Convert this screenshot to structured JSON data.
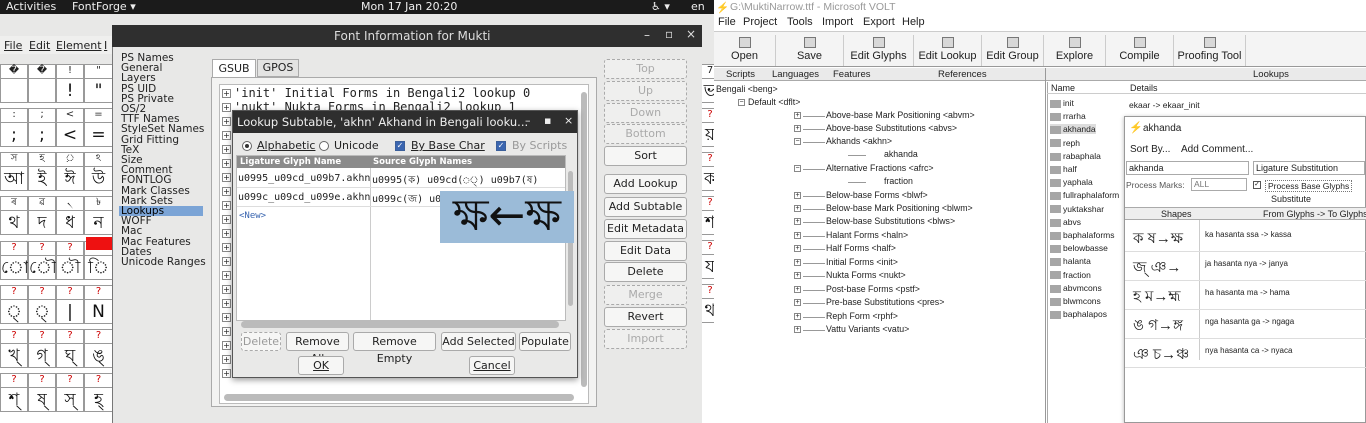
{
  "topbar": {
    "activities": "Activities",
    "app_menu": "FontForge ▾",
    "clock": "Mon 17 Jan  20:20",
    "sys_icons": "♿ ▾",
    "lang": "en"
  },
  "fontforge": {
    "menubar": [
      "File",
      "Edit",
      "Element",
      "I"
    ],
    "window_title": "Font Information for Mukti",
    "nav_items": [
      "PS Names",
      "General",
      "Layers",
      "PS UID",
      "PS Private",
      "OS/2",
      "TTF Names",
      "StyleSet Names",
      "Grid Fitting",
      "TeX",
      "Size",
      "Comment",
      "FONTLOG",
      "Mark Classes",
      "Mark Sets",
      "Lookups",
      "WOFF",
      "Mac",
      "Mac Features",
      "Dates",
      "Unicode Ranges"
    ],
    "nav_selected": "Lookups",
    "tabs": [
      "GSUB",
      "GPOS"
    ],
    "lookups": [
      "'init' Initial Forms in Bengali2 lookup 0",
      "'nukt' Nukta Forms in Bengali2 lookup 1"
    ],
    "side_buttons": [
      {
        "label": "Top",
        "enabled": false
      },
      {
        "label": "Up",
        "enabled": false
      },
      {
        "label": "Down",
        "enabled": false
      },
      {
        "label": "Bottom",
        "enabled": false
      },
      {
        "label": "Sort",
        "enabled": true
      },
      {
        "label": "Add Lookup",
        "enabled": true
      },
      {
        "label": "Add Subtable",
        "enabled": true
      },
      {
        "label": "Edit Metadata",
        "enabled": true
      },
      {
        "label": "Edit Data",
        "enabled": true
      },
      {
        "label": "Delete",
        "enabled": true
      },
      {
        "label": "Merge",
        "enabled": false
      },
      {
        "label": "Revert",
        "enabled": true
      },
      {
        "label": "Import",
        "enabled": false
      }
    ],
    "grid_left_labels": [
      [
        "�",
        "�",
        "!",
        "\""
      ],
      [
        ":",
        ";",
        "<",
        "="
      ],
      [
        "স",
        "হ",
        "়",
        "ঽ"
      ],
      [
        "ৰ",
        "ৱ",
        "৲",
        "৳"
      ],
      [
        "?",
        "?",
        "?",
        "?"
      ],
      [
        "?",
        "?",
        "?",
        "?"
      ],
      [
        "?",
        "?",
        "?",
        "?"
      ],
      [
        "?",
        "?",
        "?",
        "?"
      ]
    ],
    "grid_left_glyphs": [
      [
        "",
        "",
        "!",
        "\""
      ],
      [
        ";",
        ";",
        "<",
        "="
      ],
      [
        "আ",
        "ই",
        "ঈ",
        "উ"
      ],
      [
        "থ",
        "দ",
        "ধ",
        "ন"
      ],
      [
        "ো",
        "ৌ",
        "ৗ",
        "ি"
      ],
      [
        "্",
        "্",
        "|",
        "N"
      ],
      [
        "খ্",
        "গ্",
        "ঘ্",
        "ঙ্"
      ],
      [
        "শ্",
        "ষ্",
        "স্",
        "হ্"
      ]
    ],
    "grid_right_labels": [
      "7",
      "?",
      "?",
      "?",
      "?",
      "?",
      "?"
    ],
    "grid_right_glyphs": [
      "ভ",
      "য়",
      "ক",
      "শ",
      "য",
      "থ"
    ]
  },
  "dialog": {
    "title": "Lookup Subtable, 'akhn' Akhand in Bengali looku...",
    "controls": [
      "–",
      "▪",
      "×"
    ],
    "options": {
      "alphabetic": "Alphabetic",
      "unicode": "Unicode",
      "by_base_char": "By Base Char",
      "by_scripts": "By Scripts"
    },
    "columns": [
      "Ligature Glyph Name",
      "Source Glyph Names"
    ],
    "rows": [
      {
        "lig": "u0995_u09cd_u09b7.akhn",
        "src": "u0995(ক) u09cd(◌্) u09b7(ষ)"
      },
      {
        "lig": "u099c_u09cd_u099e.akhn",
        "src": "u099c(জ) u09"
      }
    ],
    "new_row": "<New>",
    "preview": "ক্ষ←ক্ষ",
    "buttons": [
      "Delete",
      "Remove All",
      "Remove Empty",
      "Add Selected",
      "Populate"
    ],
    "ok": "OK",
    "cancel": "Cancel"
  },
  "volt": {
    "title": "G:\\MuktiNarrow.ttf - Microsoft VOLT",
    "menu": [
      "File",
      "Project",
      "Tools",
      "Import",
      "Export",
      "Help"
    ],
    "toolbar": [
      "Open",
      "Save",
      "Edit Glyphs",
      "Edit Lookup",
      "Edit Group",
      "Explore",
      "Compile",
      "Proofing Tool"
    ],
    "toolbar_icons": [
      "folder-icon",
      "disk-icon",
      "glyph-icon",
      "lookup-icon",
      "group-icon",
      "explore-icon",
      "compile-icon",
      "proof-icon"
    ],
    "header_tabs": [
      "Scripts",
      "Languages",
      "Features",
      "References",
      "Lookups"
    ],
    "tree_root": "Bengali <beng>",
    "tree_lang": "Default <dflt>",
    "features": [
      "Above-base Mark Positioning <abvm>",
      "Above-base Substitutions <abvs>",
      "Akhands <akhn>",
      "akhanda",
      "Alternative Fractions <afrc>",
      "fraction",
      "Below-base Forms <blwf>",
      "Below-base Mark Positioning <blwm>",
      "Below-base Substitutions <blws>",
      "Halant Forms <haln>",
      "Half Forms <half>",
      "Initial Forms <init>",
      "Nukta Forms <nukt>",
      "Post-base Forms <pstf>",
      "Pre-base Substitutions <pres>",
      "Reph Form <rphf>",
      "Vattu Variants <vatu>"
    ],
    "lookup_cols": [
      "Name",
      "Details"
    ],
    "lookup_first_detail": "ekaar -> ekaar_init",
    "lookups": [
      "init",
      "rrarha",
      "akhanda",
      "reph",
      "rabaphala",
      "half",
      "yaphala",
      "fullraphalaform",
      "yuktakshar",
      "abvs",
      "baphalaforms",
      "belowbasse",
      "halanta",
      "fraction",
      "abvmcons",
      "blwmcons",
      "baphalapos"
    ],
    "lookup_selected": "akhanda",
    "sub": {
      "title": "akhanda",
      "menu": [
        "Sort By...",
        "Add Comment..."
      ],
      "name_value": "akhanda",
      "type_value": "Ligature Substitution",
      "process_marks_label": "Process Marks:",
      "process_marks_value": "ALL",
      "process_base": "Process Base Glyphs",
      "substitute": "Substitute",
      "col_shapes": "Shapes",
      "col_glyphs": "From Glyphs -> To Glyphs",
      "rows": [
        {
          "shape": "ক ষ→ক্ষ",
          "desc": "ka hasanta ssa -> kassa"
        },
        {
          "shape": "জ্ ঞ→",
          "desc": "ja hasanta nya -> janya"
        },
        {
          "shape": "হ ম→হ্ম",
          "desc": "ha hasanta ma -> hama"
        },
        {
          "shape": "ঙ গ→ঙ্গ",
          "desc": "nga hasanta ga -> ngaga"
        },
        {
          "shape": "ঞ চ→ঞ্চ",
          "desc": "nya hasanta ca -> nyaca"
        }
      ]
    }
  }
}
